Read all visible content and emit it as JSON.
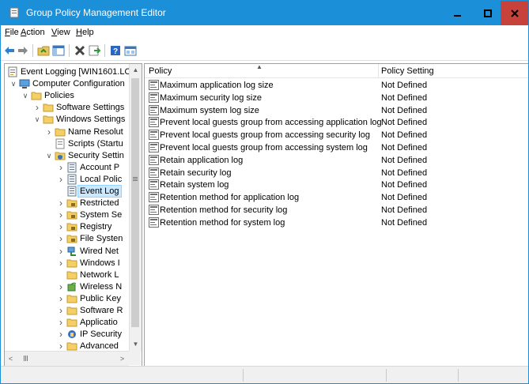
{
  "window": {
    "title": "Group Policy Management Editor"
  },
  "menu": [
    {
      "mnemonic": "F",
      "rest": "ile"
    },
    {
      "mnemonic": "A",
      "rest": "ction"
    },
    {
      "mnemonic": "V",
      "rest": "iew"
    },
    {
      "mnemonic": "H",
      "rest": "elp"
    }
  ],
  "toolbar": {
    "icons": [
      "back-arrow-icon",
      "forward-arrow-icon",
      "up-folder-icon",
      "show-hide-tree-icon",
      "delete-icon",
      "export-list-icon",
      "help-icon",
      "properties-icon"
    ]
  },
  "tree": [
    {
      "label": "Event Logging [WIN1601.LO",
      "indent": 0,
      "expander": "",
      "icon": "gpo-icon"
    },
    {
      "label": "Computer Configuration",
      "indent": 1,
      "expander": "v",
      "icon": "computer-icon"
    },
    {
      "label": "Policies",
      "indent": 2,
      "expander": "v",
      "icon": "folder-icon"
    },
    {
      "label": "Software Settings",
      "indent": 3,
      "expander": ">",
      "icon": "folder-icon"
    },
    {
      "label": "Windows Settings",
      "indent": 3,
      "expander": "v",
      "icon": "folder-icon"
    },
    {
      "label": "Name Resolut",
      "indent": 4,
      "expander": ">",
      "icon": "folder-icon"
    },
    {
      "label": "Scripts (Startu",
      "indent": 4,
      "expander": "",
      "icon": "script-icon"
    },
    {
      "label": "Security Settin",
      "indent": 4,
      "expander": "v",
      "icon": "security-icon"
    },
    {
      "label": "Account P",
      "indent": 5,
      "expander": ">",
      "icon": "policy-icon"
    },
    {
      "label": "Local Polic",
      "indent": 5,
      "expander": ">",
      "icon": "policy-icon"
    },
    {
      "label": "Event Log",
      "indent": 5,
      "expander": "",
      "icon": "policy-icon",
      "selected": true
    },
    {
      "label": "Restricted",
      "indent": 5,
      "expander": ">",
      "icon": "lock-folder-icon"
    },
    {
      "label": "System Se",
      "indent": 5,
      "expander": ">",
      "icon": "lock-folder-icon"
    },
    {
      "label": "Registry",
      "indent": 5,
      "expander": ">",
      "icon": "lock-folder-icon"
    },
    {
      "label": "File Systen",
      "indent": 5,
      "expander": ">",
      "icon": "lock-folder-icon"
    },
    {
      "label": "Wired Net",
      "indent": 5,
      "expander": ">",
      "icon": "network-icon"
    },
    {
      "label": "Windows I",
      "indent": 5,
      "expander": ">",
      "icon": "folder-icon"
    },
    {
      "label": "Network L",
      "indent": 5,
      "expander": "",
      "icon": "folder-icon"
    },
    {
      "label": "Wireless N",
      "indent": 5,
      "expander": ">",
      "icon": "wireless-icon"
    },
    {
      "label": "Public Key",
      "indent": 5,
      "expander": ">",
      "icon": "folder-icon"
    },
    {
      "label": "Software R",
      "indent": 5,
      "expander": ">",
      "icon": "folder-icon"
    },
    {
      "label": "Applicatio",
      "indent": 5,
      "expander": ">",
      "icon": "folder-icon"
    },
    {
      "label": "IP Security",
      "indent": 5,
      "expander": ">",
      "icon": "ipsec-icon"
    },
    {
      "label": "Advanced",
      "indent": 5,
      "expander": ">",
      "icon": "folder-icon"
    }
  ],
  "list": {
    "columns": {
      "policy": "Policy",
      "setting": "Policy Setting"
    },
    "rows": [
      {
        "policy": "Maximum application log size",
        "setting": "Not Defined"
      },
      {
        "policy": "Maximum security log size",
        "setting": "Not Defined"
      },
      {
        "policy": "Maximum system log size",
        "setting": "Not Defined"
      },
      {
        "policy": "Prevent local guests group from accessing application log",
        "setting": "Not Defined"
      },
      {
        "policy": "Prevent local guests group from accessing security log",
        "setting": "Not Defined"
      },
      {
        "policy": "Prevent local guests group from accessing system log",
        "setting": "Not Defined"
      },
      {
        "policy": "Retain application log",
        "setting": "Not Defined"
      },
      {
        "policy": "Retain security log",
        "setting": "Not Defined"
      },
      {
        "policy": "Retain system log",
        "setting": "Not Defined"
      },
      {
        "policy": "Retention method for application log",
        "setting": "Not Defined"
      },
      {
        "policy": "Retention method for security log",
        "setting": "Not Defined"
      },
      {
        "policy": "Retention method for system log",
        "setting": "Not Defined"
      }
    ]
  },
  "colors": {
    "titlebar": "#1c8fd9",
    "close": "#c7423a",
    "selection": "#cce8ff"
  }
}
